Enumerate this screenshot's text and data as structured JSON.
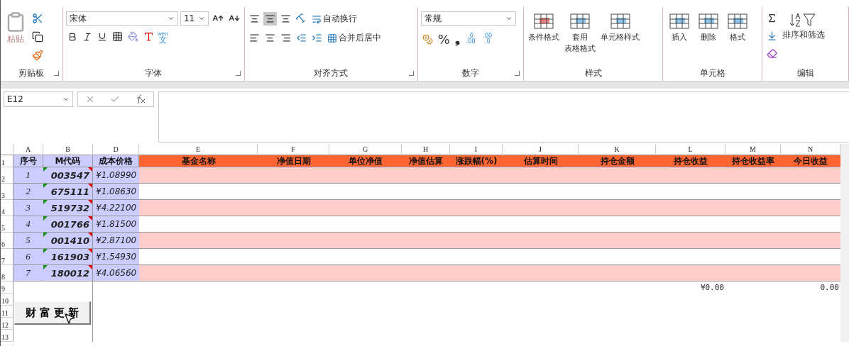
{
  "ribbon": {
    "groups": [
      {
        "kind": "clipboard",
        "label": "剪贴板",
        "paste": "粘贴"
      },
      {
        "kind": "font",
        "label": "字体",
        "font_name": "宋体",
        "font_size": "11",
        "phonetic_top": "wén",
        "phonetic_bottom": "文"
      },
      {
        "kind": "alignment",
        "label": "对齐方式",
        "vertical": [
          {
            "selected": false
          },
          {
            "selected": true
          },
          {
            "selected": false
          }
        ],
        "wrap": "自动换行",
        "merge": "合并后居中"
      },
      {
        "kind": "number",
        "label": "数字",
        "format": "常规",
        "percent": "%",
        "comma": "❟",
        "decimals": [
          {
            "top": ".0",
            "bottom": ".00"
          },
          {
            "top": ".00",
            "bottom": ".0"
          }
        ]
      },
      {
        "kind": "styles",
        "label": "样式",
        "buttons": [
          {
            "lines": [
              "条件格式"
            ]
          },
          {
            "lines": [
              "套用",
              "表格格式"
            ]
          },
          {
            "lines": [
              "单元格样式"
            ]
          }
        ]
      },
      {
        "kind": "cells",
        "label": "单元格",
        "buttons": [
          {
            "text": "插入"
          },
          {
            "text": "删除"
          },
          {
            "text": "格式"
          }
        ]
      },
      {
        "kind": "editing",
        "label": "编辑",
        "sort": "排序和筛选"
      }
    ]
  },
  "formula_bar": {
    "name_box": "E12"
  },
  "sheet": {
    "column_letters": [
      "A",
      "B",
      "D",
      "E",
      "F",
      "G",
      "H",
      "I",
      "J",
      "K",
      "L",
      "M",
      "N"
    ],
    "row_numbers": [
      "1",
      "2",
      "3",
      "4",
      "5",
      "6",
      "7",
      "8",
      "9",
      "10",
      "11",
      "12",
      "13"
    ],
    "header": [
      "序号",
      "M代码",
      "成本价格",
      "基金名称",
      "净值日期",
      "单位净值",
      "净值估算",
      "涨跌幅(%)",
      "估算时间",
      "持仓金额",
      "持仓收益",
      "持仓收益率",
      "今日收益"
    ],
    "rows": [
      {
        "index": "1",
        "code": "003547",
        "cost": "¥1.08990"
      },
      {
        "index": "2",
        "code": "675111",
        "cost": "¥1.08630"
      },
      {
        "index": "3",
        "code": "519732",
        "cost": "¥4.22100"
      },
      {
        "index": "4",
        "code": "001766",
        "cost": "¥1.81500"
      },
      {
        "index": "5",
        "code": "001410",
        "cost": "¥2.87100"
      },
      {
        "index": "6",
        "code": "161903",
        "cost": "¥1.54930"
      },
      {
        "index": "7",
        "code": "180012",
        "cost": "¥4.06560"
      }
    ],
    "totals": {
      "holding_profit": "¥0.00",
      "today_profit": "0.00"
    },
    "update_button": "财 富 更 新"
  }
}
